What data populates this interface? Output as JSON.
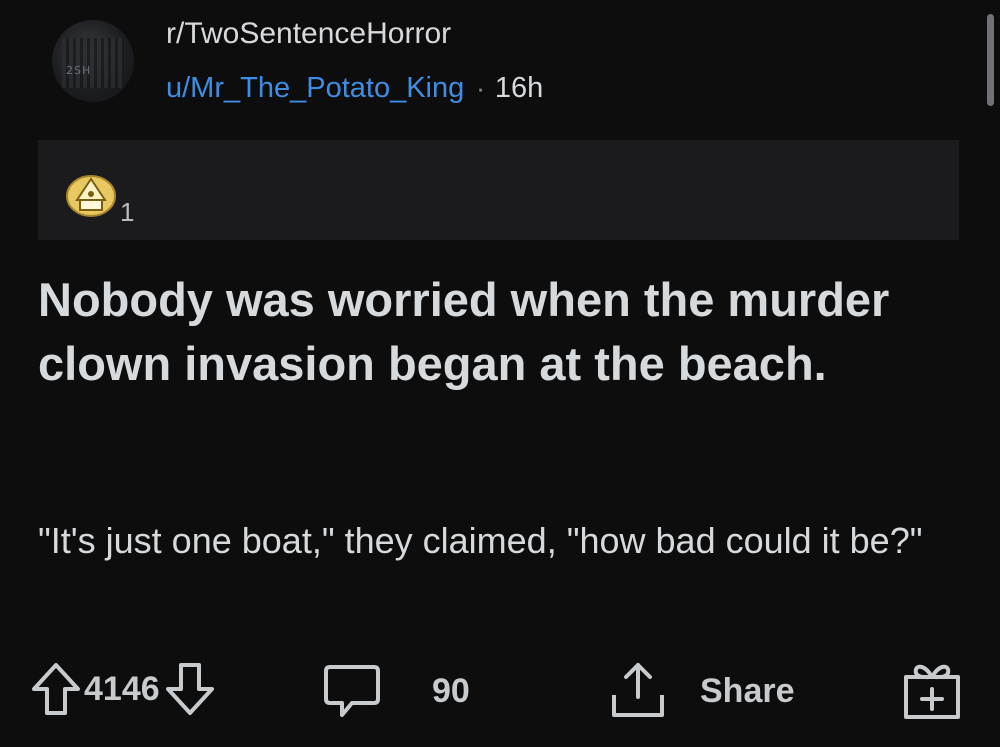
{
  "post": {
    "subreddit": "r/TwoSentenceHorror",
    "subreddit_avatar_text": "2SH",
    "author": "u/Mr_The_Potato_King",
    "separator": "·",
    "age": "16h",
    "award_count": "1",
    "title": "Nobody was worried when the murder clown invasion began at the beach.",
    "body": "\"It's just one boat,\" they claimed, \"how bad could it be?\""
  },
  "actions": {
    "vote_score": "4146",
    "comment_count": "90",
    "share_label": "Share"
  },
  "icons": {
    "upvote": "arrow-up-icon",
    "downvote": "arrow-down-icon",
    "comment": "comment-bubble-icon",
    "share": "share-icon",
    "award": "gift-award-icon"
  },
  "colors": {
    "background": "#0d0d0e",
    "award_bar": "#1b1b1d",
    "author_link": "#3f8de2",
    "text": "#d7dadc"
  }
}
